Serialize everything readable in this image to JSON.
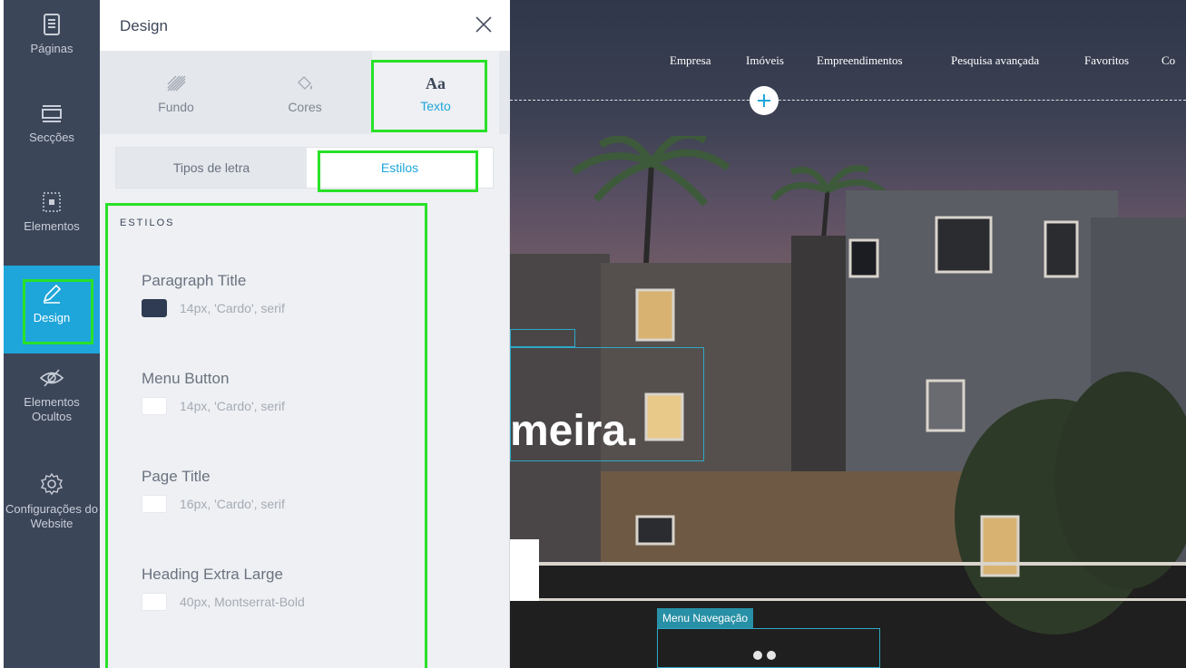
{
  "sidebar": {
    "items": [
      {
        "label": "Páginas",
        "icon": "pages-icon"
      },
      {
        "label": "Secções",
        "icon": "sections-icon"
      },
      {
        "label": "Elementos",
        "icon": "elements-icon"
      },
      {
        "label": "Design",
        "icon": "pencil-icon",
        "active": true
      },
      {
        "label": "Elementos Ocultos",
        "icon": "hidden-eye-icon"
      },
      {
        "label": "Configurações do Website",
        "icon": "gear-icon"
      }
    ]
  },
  "panel": {
    "title": "Design",
    "close_icon": "close-icon",
    "tabs": [
      {
        "label": "Fundo",
        "icon": "background-pattern-icon"
      },
      {
        "label": "Cores",
        "icon": "paint-bucket-icon"
      },
      {
        "label": "Texto",
        "icon_text": "Aa",
        "active": true
      }
    ],
    "subtabs": [
      {
        "label": "Tipos de letra"
      },
      {
        "label": "Estilos",
        "active": true
      }
    ],
    "section_label": "ESTILOS",
    "styles": [
      {
        "name": "Paragraph Title",
        "desc": "14px, 'Cardo', serif",
        "swatch": "#2f3b52"
      },
      {
        "name": "Menu Button",
        "desc": "14px, 'Cardo', serif",
        "swatch": "#ffffff"
      },
      {
        "name": "Page Title",
        "desc": "16px, 'Cardo', serif",
        "swatch": "#ffffff"
      },
      {
        "name": "Heading Extra Large",
        "desc": "40px, Montserrat-Bold",
        "swatch": "#ffffff"
      }
    ]
  },
  "preview": {
    "nav": [
      "Empresa",
      "Imóveis",
      "Empreendimentos",
      "Pesquisa avançada",
      "Favoritos",
      "Co"
    ],
    "hero_text": "meira.",
    "menu_label": "Menu Navegação"
  },
  "colors": {
    "accent": "#1ea6db",
    "highlight": "#28e128",
    "sidebar_bg": "#3c4659"
  }
}
